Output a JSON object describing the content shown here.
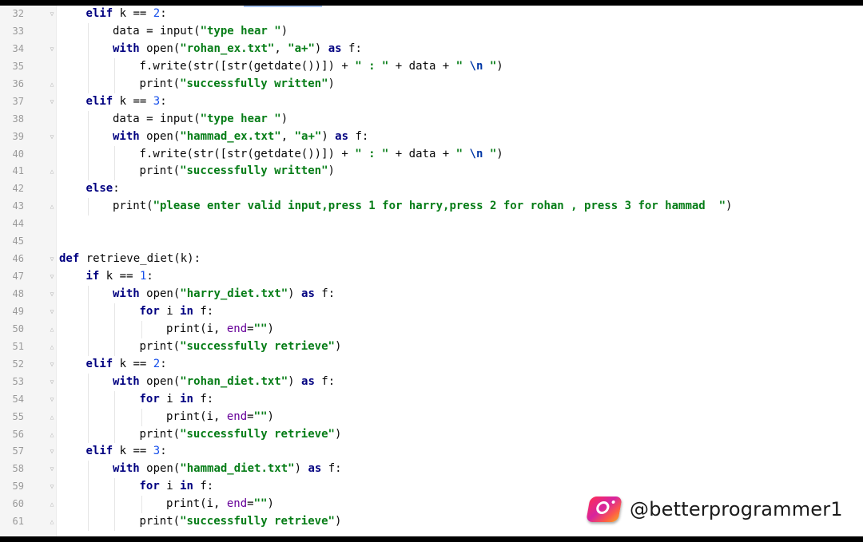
{
  "editor": {
    "lines": [
      {
        "num": "32",
        "fold": "start",
        "indent": 1,
        "tokens": [
          [
            "kw",
            "elif"
          ],
          [
            "",
            " k == "
          ],
          [
            "num",
            "2"
          ],
          [
            "",
            ":"
          ]
        ]
      },
      {
        "num": "33",
        "fold": "",
        "indent": 2,
        "tokens": [
          [
            "",
            "data = input("
          ],
          [
            "str",
            "\"type hear \""
          ],
          [
            "",
            ")"
          ]
        ]
      },
      {
        "num": "34",
        "fold": "start",
        "indent": 2,
        "tokens": [
          [
            "kw",
            "with"
          ],
          [
            "",
            " open("
          ],
          [
            "str",
            "\"rohan_ex.txt\""
          ],
          [
            "",
            ", "
          ],
          [
            "str",
            "\"a+\""
          ],
          [
            "",
            ") "
          ],
          [
            "kw",
            "as"
          ],
          [
            "",
            " f:"
          ]
        ]
      },
      {
        "num": "35",
        "fold": "",
        "indent": 3,
        "tokens": [
          [
            "",
            "f.write(str([str(getdate())]) + "
          ],
          [
            "str",
            "\" : \""
          ],
          [
            "",
            " + data + "
          ],
          [
            "str",
            "\" "
          ],
          [
            "esc",
            "\\n"
          ],
          [
            "str",
            " \""
          ],
          [
            "",
            ")"
          ]
        ]
      },
      {
        "num": "36",
        "fold": "end",
        "indent": 3,
        "tokens": [
          [
            "",
            "print("
          ],
          [
            "str",
            "\"successfully written\""
          ],
          [
            "",
            ")"
          ]
        ]
      },
      {
        "num": "37",
        "fold": "start",
        "indent": 1,
        "tokens": [
          [
            "kw",
            "elif"
          ],
          [
            "",
            " k == "
          ],
          [
            "num",
            "3"
          ],
          [
            "",
            ":"
          ]
        ]
      },
      {
        "num": "38",
        "fold": "",
        "indent": 2,
        "tokens": [
          [
            "",
            "data = input("
          ],
          [
            "str",
            "\"type hear \""
          ],
          [
            "",
            ")"
          ]
        ]
      },
      {
        "num": "39",
        "fold": "start",
        "indent": 2,
        "tokens": [
          [
            "kw",
            "with"
          ],
          [
            "",
            " open("
          ],
          [
            "str",
            "\"hammad_ex.txt\""
          ],
          [
            "",
            ", "
          ],
          [
            "str",
            "\"a+\""
          ],
          [
            "",
            ") "
          ],
          [
            "kw",
            "as"
          ],
          [
            "",
            " f:"
          ]
        ]
      },
      {
        "num": "40",
        "fold": "",
        "indent": 3,
        "tokens": [
          [
            "",
            "f.write(str([str(getdate())]) + "
          ],
          [
            "str",
            "\" : \""
          ],
          [
            "",
            " + data + "
          ],
          [
            "str",
            "\" "
          ],
          [
            "esc",
            "\\n"
          ],
          [
            "str",
            " \""
          ],
          [
            "",
            ")"
          ]
        ]
      },
      {
        "num": "41",
        "fold": "end",
        "indent": 3,
        "tokens": [
          [
            "",
            "print("
          ],
          [
            "str",
            "\"successfully written\""
          ],
          [
            "",
            ")"
          ]
        ]
      },
      {
        "num": "42",
        "fold": "",
        "indent": 1,
        "tokens": [
          [
            "kw",
            "else"
          ],
          [
            "",
            ":"
          ]
        ]
      },
      {
        "num": "43",
        "fold": "end",
        "indent": 2,
        "tokens": [
          [
            "",
            "print("
          ],
          [
            "str",
            "\"please enter valid input,press 1 for harry,press 2 for rohan , press 3 for hammad  \""
          ],
          [
            "",
            ")"
          ]
        ]
      },
      {
        "num": "44",
        "fold": "",
        "indent": 0,
        "tokens": []
      },
      {
        "num": "45",
        "fold": "",
        "indent": 0,
        "tokens": []
      },
      {
        "num": "46",
        "fold": "start",
        "indent": 0,
        "tokens": [
          [
            "kw",
            "def"
          ],
          [
            "",
            " retrieve_diet(k):"
          ]
        ]
      },
      {
        "num": "47",
        "fold": "start",
        "indent": 1,
        "tokens": [
          [
            "kw",
            "if"
          ],
          [
            "",
            " k == "
          ],
          [
            "num",
            "1"
          ],
          [
            "",
            ":"
          ]
        ]
      },
      {
        "num": "48",
        "fold": "start",
        "indent": 2,
        "tokens": [
          [
            "kw",
            "with"
          ],
          [
            "",
            " open("
          ],
          [
            "str",
            "\"harry_diet.txt\""
          ],
          [
            "",
            ") "
          ],
          [
            "kw",
            "as"
          ],
          [
            "",
            " f:"
          ]
        ]
      },
      {
        "num": "49",
        "fold": "start",
        "indent": 3,
        "tokens": [
          [
            "kw",
            "for"
          ],
          [
            "",
            " i "
          ],
          [
            "kw",
            "in"
          ],
          [
            "",
            " f:"
          ]
        ]
      },
      {
        "num": "50",
        "fold": "end",
        "indent": 4,
        "tokens": [
          [
            "",
            "print(i, "
          ],
          [
            "kwarg",
            "end"
          ],
          [
            "",
            "="
          ],
          [
            "str",
            "\"\""
          ],
          [
            "",
            ")"
          ]
        ]
      },
      {
        "num": "51",
        "fold": "end",
        "indent": 3,
        "tokens": [
          [
            "",
            "print("
          ],
          [
            "str",
            "\"successfully retrieve\""
          ],
          [
            "",
            ")"
          ]
        ]
      },
      {
        "num": "52",
        "fold": "start",
        "indent": 1,
        "tokens": [
          [
            "kw",
            "elif"
          ],
          [
            "",
            " k == "
          ],
          [
            "num",
            "2"
          ],
          [
            "",
            ":"
          ]
        ]
      },
      {
        "num": "53",
        "fold": "start",
        "indent": 2,
        "tokens": [
          [
            "kw",
            "with"
          ],
          [
            "",
            " open("
          ],
          [
            "str",
            "\"rohan_diet.txt\""
          ],
          [
            "",
            ") "
          ],
          [
            "kw",
            "as"
          ],
          [
            "",
            " f:"
          ]
        ]
      },
      {
        "num": "54",
        "fold": "start",
        "indent": 3,
        "tokens": [
          [
            "kw",
            "for"
          ],
          [
            "",
            " i "
          ],
          [
            "kw",
            "in"
          ],
          [
            "",
            " f:"
          ]
        ]
      },
      {
        "num": "55",
        "fold": "end",
        "indent": 4,
        "tokens": [
          [
            "",
            "print(i, "
          ],
          [
            "kwarg",
            "end"
          ],
          [
            "",
            "="
          ],
          [
            "str",
            "\"\""
          ],
          [
            "",
            ")"
          ]
        ]
      },
      {
        "num": "56",
        "fold": "end",
        "indent": 3,
        "tokens": [
          [
            "",
            "print("
          ],
          [
            "str",
            "\"successfully retrieve\""
          ],
          [
            "",
            ")"
          ]
        ]
      },
      {
        "num": "57",
        "fold": "start",
        "indent": 1,
        "tokens": [
          [
            "kw",
            "elif"
          ],
          [
            "",
            " k == "
          ],
          [
            "num",
            "3"
          ],
          [
            "",
            ":"
          ]
        ]
      },
      {
        "num": "58",
        "fold": "start",
        "indent": 2,
        "tokens": [
          [
            "kw",
            "with"
          ],
          [
            "",
            " open("
          ],
          [
            "str",
            "\"hammad_diet.txt\""
          ],
          [
            "",
            ") "
          ],
          [
            "kw",
            "as"
          ],
          [
            "",
            " f:"
          ]
        ]
      },
      {
        "num": "59",
        "fold": "start",
        "indent": 3,
        "tokens": [
          [
            "kw",
            "for"
          ],
          [
            "",
            " i "
          ],
          [
            "kw",
            "in"
          ],
          [
            "",
            " f:"
          ]
        ]
      },
      {
        "num": "60",
        "fold": "end",
        "indent": 4,
        "tokens": [
          [
            "",
            "print(i, "
          ],
          [
            "kwarg",
            "end"
          ],
          [
            "",
            "="
          ],
          [
            "str",
            "\"\""
          ],
          [
            "",
            ")"
          ]
        ]
      },
      {
        "num": "61",
        "fold": "end",
        "indent": 3,
        "tokens": [
          [
            "",
            "print("
          ],
          [
            "str",
            "\"successfully retrieve\""
          ],
          [
            "",
            ")"
          ]
        ]
      }
    ]
  },
  "watermark": {
    "icon": "instagram-icon",
    "handle": "@betterprogrammer1"
  }
}
